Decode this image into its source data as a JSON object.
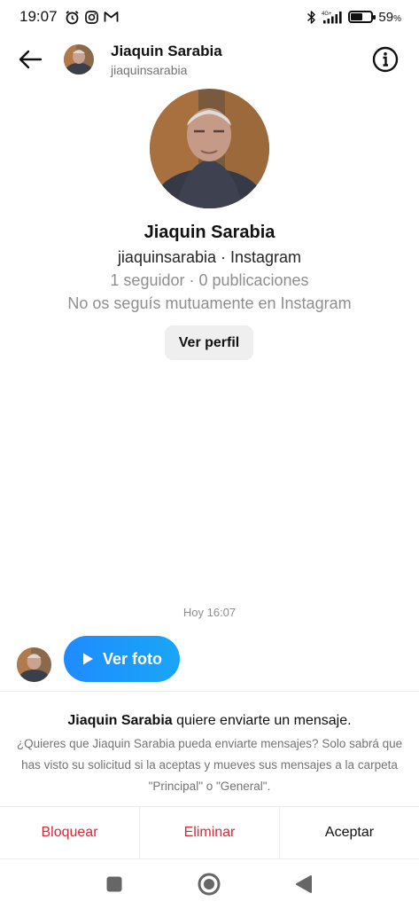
{
  "status_bar": {
    "time": "19:07",
    "network": "4G+",
    "battery_percent": "59",
    "battery_unit": "%",
    "battery_level": 0.59,
    "icons": [
      "alarm-icon",
      "instagram-icon",
      "gmail-icon",
      "bluetooth-icon",
      "signal-icon",
      "battery-icon"
    ]
  },
  "header": {
    "name": "Jiaquin Sarabia",
    "username": "jiaquinsarabia",
    "back_icon": "arrow-left-icon",
    "info_icon": "info-icon"
  },
  "profile": {
    "name": "Jiaquin Sarabia",
    "subtitle": "jiaquinsarabia · Instagram",
    "stats": "1 seguidor · 0 publicaciones",
    "mutual": "No os seguís mutuamente en Instagram",
    "view_profile_label": "Ver perfil"
  },
  "conversation": {
    "timestamp": "Hoy 16:07",
    "photo_bubble_label": "Ver foto",
    "play_icon": "play-icon"
  },
  "request": {
    "title_name": "Jiaquin Sarabia",
    "title_rest": " quiere enviarte un mensaje.",
    "body": "¿Quieres que Jiaquin Sarabia pueda enviarte mensajes? Solo sabrá que has visto su solicitud si la aceptas y mueves sus mensajes a la carpeta \"Principal\" o \"General\"."
  },
  "actions": {
    "block": "Bloquear",
    "delete": "Eliminar",
    "accept": "Aceptar"
  },
  "colors": {
    "destructive": "#d12b3a",
    "bubble_start": "#1e8bff",
    "bubble_end": "#1aa6f7",
    "muted": "#8e8e8e"
  }
}
